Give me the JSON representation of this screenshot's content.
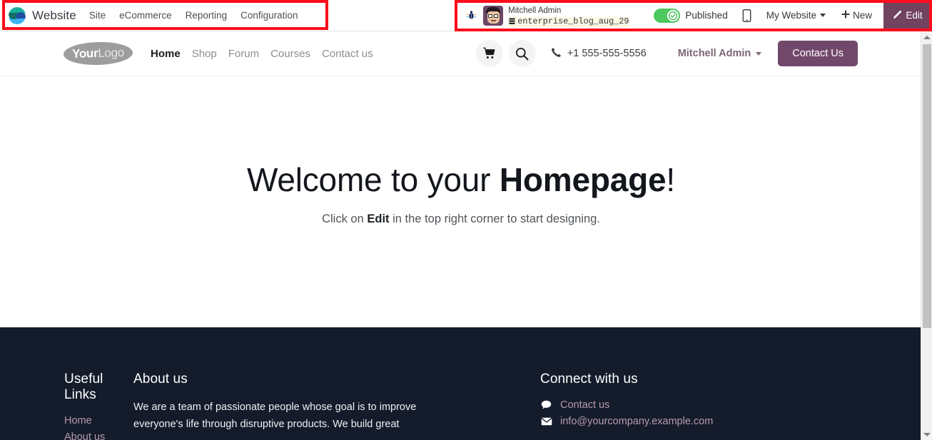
{
  "backend": {
    "app_name": "Website",
    "menus": [
      {
        "label": "Site"
      },
      {
        "label": "eCommerce"
      },
      {
        "label": "Reporting"
      },
      {
        "label": "Configuration"
      }
    ],
    "bug_icon": "bug-icon",
    "user": {
      "name": "Mitchell Admin",
      "database": "enterprise_blog_aug_29",
      "db_icon": "database-icon",
      "avatar": "user-avatar"
    },
    "publish": {
      "state_label": "Published",
      "toggle_on": true,
      "check_icon": "check-circle-icon"
    },
    "mobile_preview_icon": "mobile-phone-icon",
    "site_selector": {
      "label": "My Website",
      "caret_icon": "chevron-down-icon"
    },
    "new_button": {
      "label": "New",
      "plus_icon": "plus-icon"
    },
    "edit_button": {
      "label": "Edit",
      "pencil_icon": "pencil-icon"
    }
  },
  "website": {
    "logo": {
      "bold_part": "Your",
      "light_part": "Logo"
    },
    "nav": [
      {
        "label": "Home",
        "active": true
      },
      {
        "label": "Shop",
        "active": false
      },
      {
        "label": "Forum",
        "active": false
      },
      {
        "label": "Courses",
        "active": false
      },
      {
        "label": "Contact us",
        "active": false
      }
    ],
    "cart_icon": "shopping-cart-icon",
    "search_icon": "search-icon",
    "phone": {
      "icon": "phone-icon",
      "number": "+1 555-555-5556"
    },
    "user_menu": {
      "label": "Mitchell Admin",
      "caret_icon": "chevron-down-icon"
    },
    "cta_button": {
      "label": "Contact Us"
    }
  },
  "hero": {
    "title_plain": "Welcome to your ",
    "title_bold": "Homepage",
    "title_end": "!",
    "sub_pre": "Click on ",
    "sub_bold": "Edit",
    "sub_post": " in the top right corner to start designing."
  },
  "footer": {
    "useful_links": {
      "title": "Useful Links",
      "links": [
        {
          "label": "Home"
        },
        {
          "label": "About us"
        }
      ]
    },
    "about": {
      "title": "About us",
      "text": "We are a team of passionate people whose goal is to improve everyone's life through disruptive products. We build great"
    },
    "connect": {
      "title": "Connect with us",
      "items": [
        {
          "icon": "comment-icon",
          "label": "Contact us"
        },
        {
          "icon": "envelope-icon",
          "label": "info@yourcompany.example.com"
        }
      ]
    }
  },
  "scrollbar": {
    "up_arrow_icon": "scroll-up-arrow-icon",
    "down_arrow_icon": "scroll-down-arrow-icon"
  },
  "colors": {
    "odoo_purple": "#71486a",
    "edit_button": "#71435f",
    "footer_bg": "#141b2b",
    "toggle_green": "#4cc85f",
    "annotation_red": "#fc0d1b",
    "footer_link": "#b79bb2"
  }
}
